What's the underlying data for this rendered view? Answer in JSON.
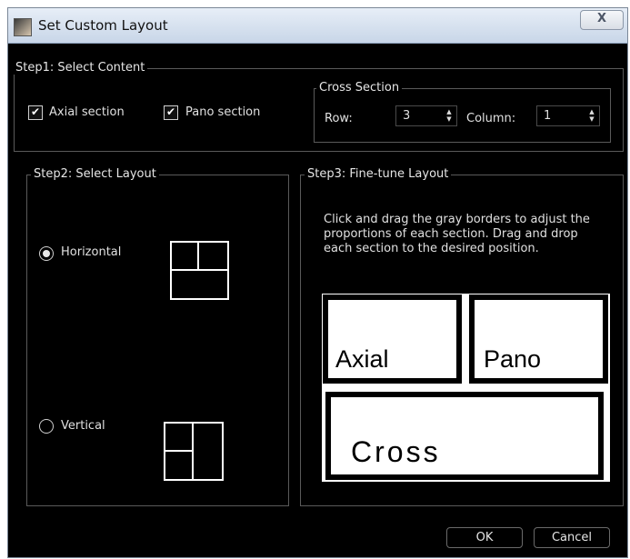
{
  "window": {
    "title": "Set Custom Layout",
    "close_label": "X"
  },
  "step1": {
    "title": "Step1: Select Content",
    "axial_label": "Axial section",
    "axial_checked": true,
    "pano_label": "Pano section",
    "pano_checked": true
  },
  "cross_section": {
    "title": "Cross Section",
    "row_label": "Row:",
    "row_value": "3",
    "column_label": "Column:",
    "column_value": "1"
  },
  "step2": {
    "title": "Step2: Select Layout",
    "horizontal_label": "Horizontal",
    "vertical_label": "Vertical",
    "selected": "Horizontal"
  },
  "step3": {
    "title": "Step3: Fine-tune Layout",
    "instructions": [
      "Click and drag the gray borders to adjust the",
      "proportions of each section. Drag and drop",
      "each section to the desired position."
    ],
    "panes": {
      "axial": "Axial",
      "pano": "Pano",
      "cross": "Cross"
    }
  },
  "buttons": {
    "ok": "OK",
    "cancel": "Cancel"
  },
  "icons": {
    "checkbox": "checkmark-icon",
    "spin": "spin-arrows-icon"
  }
}
